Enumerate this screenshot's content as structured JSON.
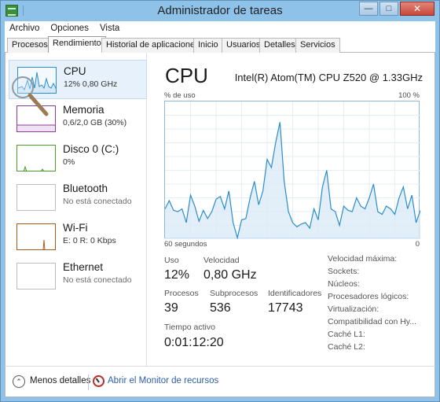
{
  "window": {
    "title": "Administrador de tareas"
  },
  "menu": [
    "Archivo",
    "Opciones",
    "Vista"
  ],
  "tabs": [
    "Procesos",
    "Rendimiento",
    "Historial de aplicaciones",
    "Inicio",
    "Usuarios",
    "Detalles",
    "Servicios"
  ],
  "active_tab": "Rendimiento",
  "resources": [
    {
      "name": "CPU",
      "detail": "12% 0,80 GHz",
      "color": "#2b8dcb",
      "selected": true
    },
    {
      "name": "Memoria",
      "detail": "0,6/2,0 GB (30%)",
      "color": "#8b3a9e",
      "selected": false
    },
    {
      "name": "Disco 0 (C:)",
      "detail": "0%",
      "color": "#4a9c2d",
      "selected": false
    },
    {
      "name": "Bluetooth",
      "detail": "No está conectado",
      "color": "#a6a6a6",
      "selected": false
    },
    {
      "name": "Wi-Fi",
      "detail": "E: 0 R: 0 Kbps",
      "color": "#a65a1a",
      "selected": false
    },
    {
      "name": "Ethernet",
      "detail": "No está conectado",
      "color": "#a6a6a6",
      "selected": false
    }
  ],
  "detail": {
    "title": "CPU",
    "model": "Intel(R) Atom(TM) CPU Z520 @ 1.33GHz",
    "graph_top_left": "% de uso",
    "graph_top_right": "100 %",
    "graph_bottom_left": "60 segundos",
    "graph_bottom_right": "0",
    "stats": {
      "uso_label": "Uso",
      "uso_value": "12%",
      "velocidad_label": "Velocidad",
      "velocidad_value": "0,80 GHz",
      "procesos_label": "Procesos",
      "procesos_value": "39",
      "subprocesos_label": "Subprocesos",
      "subprocesos_value": "536",
      "identificadores_label": "Identificadores",
      "identificadores_value": "17743",
      "tiempo_label": "Tiempo activo",
      "tiempo_value": "0:01:12:20"
    },
    "specs": [
      "Velocidad máxima:",
      "Sockets:",
      "Núcleos:",
      "Procesadores lógicos:",
      "Virtualización:",
      "Compatibilidad con Hy...",
      "Caché L1:",
      "Caché L2:"
    ]
  },
  "footer": {
    "less_details": "Menos detalles",
    "monitor_link": "Abrir el Monitor de recursos"
  },
  "chart_data": {
    "type": "area",
    "xlabel": "60 segundos",
    "ylabel": "% de uso",
    "ylim": [
      0,
      100
    ],
    "x_range_seconds": [
      60,
      0
    ],
    "grid": true,
    "series": [
      {
        "values": [
          22,
          28,
          21,
          20,
          22,
          12,
          32,
          24,
          13,
          21,
          15,
          20,
          29,
          31,
          22,
          35,
          12,
          1,
          14,
          15,
          30,
          42,
          25,
          35,
          58,
          52,
          70,
          85,
          42,
          20,
          12,
          9,
          11,
          12,
          8,
          22,
          14,
          38,
          50,
          22,
          20,
          10,
          24,
          21,
          20,
          30,
          24,
          22,
          30,
          40,
          20,
          18,
          24,
          22,
          18,
          30,
          38,
          22,
          32,
          12,
          21
        ]
      }
    ]
  }
}
